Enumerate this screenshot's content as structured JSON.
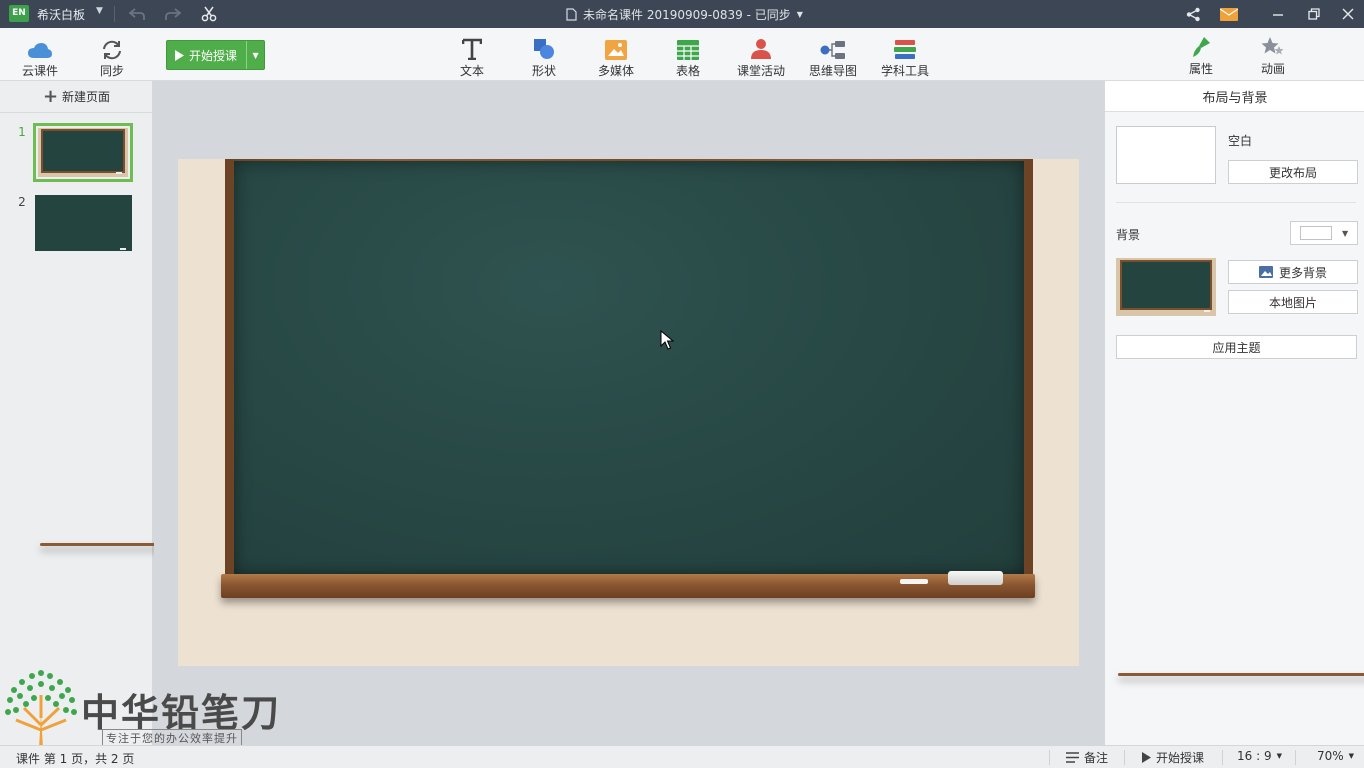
{
  "titlebar": {
    "logo": "EN",
    "app_name": "希沃白板",
    "document_title": "未命名课件 20190909-0839 - 已同步"
  },
  "ribbon": {
    "cloud_label": "云课件",
    "sync_label": "同步",
    "start_teaching_label": "开始授课",
    "tools": [
      {
        "label": "文本",
        "icon": "text-icon"
      },
      {
        "label": "形状",
        "icon": "shape-icon"
      },
      {
        "label": "多媒体",
        "icon": "media-icon"
      },
      {
        "label": "表格",
        "icon": "table-icon"
      },
      {
        "label": "课堂活动",
        "icon": "activity-icon"
      },
      {
        "label": "思维导图",
        "icon": "mindmap-icon"
      },
      {
        "label": "学科工具",
        "icon": "subject-tools-icon"
      }
    ],
    "right_tabs": [
      {
        "label": "属性",
        "icon": "brush-icon",
        "active": true
      },
      {
        "label": "动画",
        "icon": "star-icon",
        "active": false
      }
    ]
  },
  "slides_panel": {
    "new_page_label": "新建页面",
    "slides": [
      {
        "number": "1",
        "active": true
      },
      {
        "number": "2",
        "active": false
      }
    ]
  },
  "properties": {
    "header": "布局与背景",
    "layout_name": "空白",
    "change_layout_label": "更改布局",
    "background_label": "背景",
    "background_color": "#ffffff",
    "more_backgrounds_label": "更多背景",
    "local_image_label": "本地图片",
    "apply_theme_label": "应用主题"
  },
  "statusbar": {
    "page_info": "课件 第 1 页，共 2 页",
    "notes_label": "备注",
    "start_teaching_label": "开始授课",
    "aspect_ratio": "16 : 9",
    "zoom": "70%"
  },
  "watermark": {
    "title": "中华铅笔刀",
    "subtitle": "专注于您的办公效率提升"
  },
  "colors": {
    "titlebar": "#3d4654",
    "accent_green": "#4fae4a",
    "chalkboard": "#284946",
    "board_frame": "#7a4b29",
    "slide_background": "#ede1d2"
  }
}
